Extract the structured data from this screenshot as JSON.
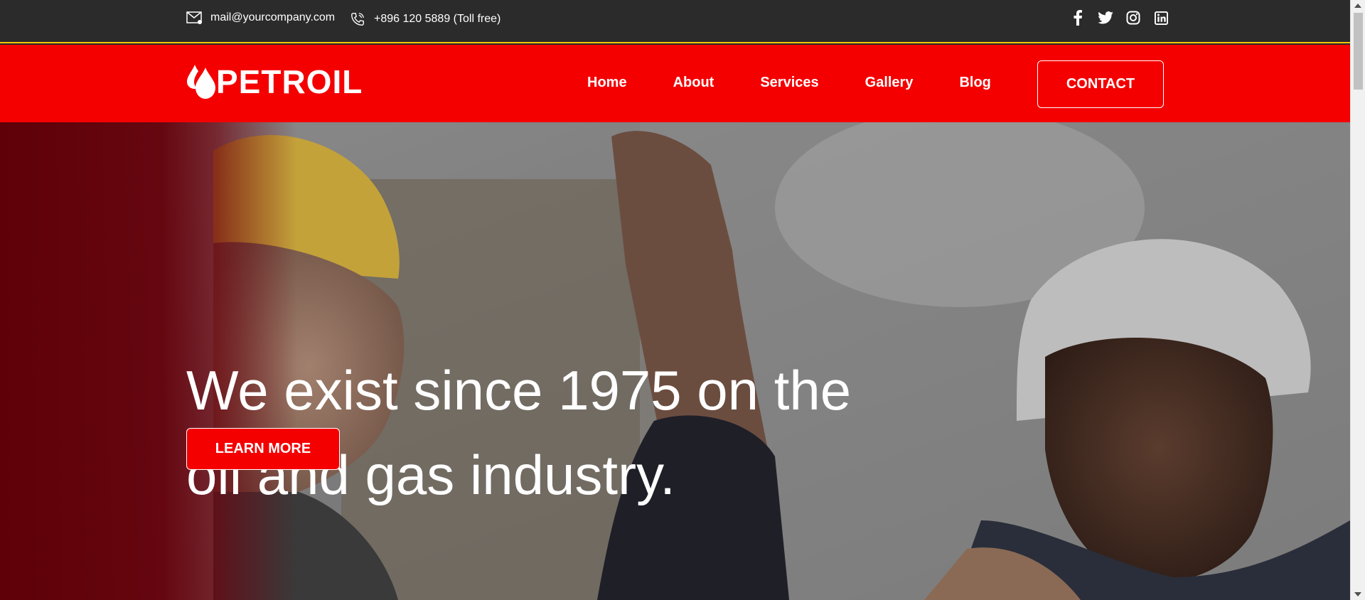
{
  "topbar": {
    "email": "mail@yourcompany.com",
    "phone": "+896 120 5889 (Toll free)",
    "social_icons": [
      "facebook-icon",
      "twitter-icon",
      "instagram-icon",
      "linkedin-icon"
    ]
  },
  "nav": {
    "logo_text": "PETROIL",
    "links": [
      "Home",
      "About",
      "Services",
      "Gallery",
      "Blog"
    ],
    "contact_label": "CONTACT"
  },
  "hero": {
    "title_line1": "We exist since 1975 on the",
    "title_line2": "oil and gas industry.",
    "cta_label": "LEARN MORE"
  },
  "colors": {
    "brand_red": "#f50000",
    "topbar_bg": "#2b2b2b",
    "accent_yellow": "#f5c400"
  }
}
